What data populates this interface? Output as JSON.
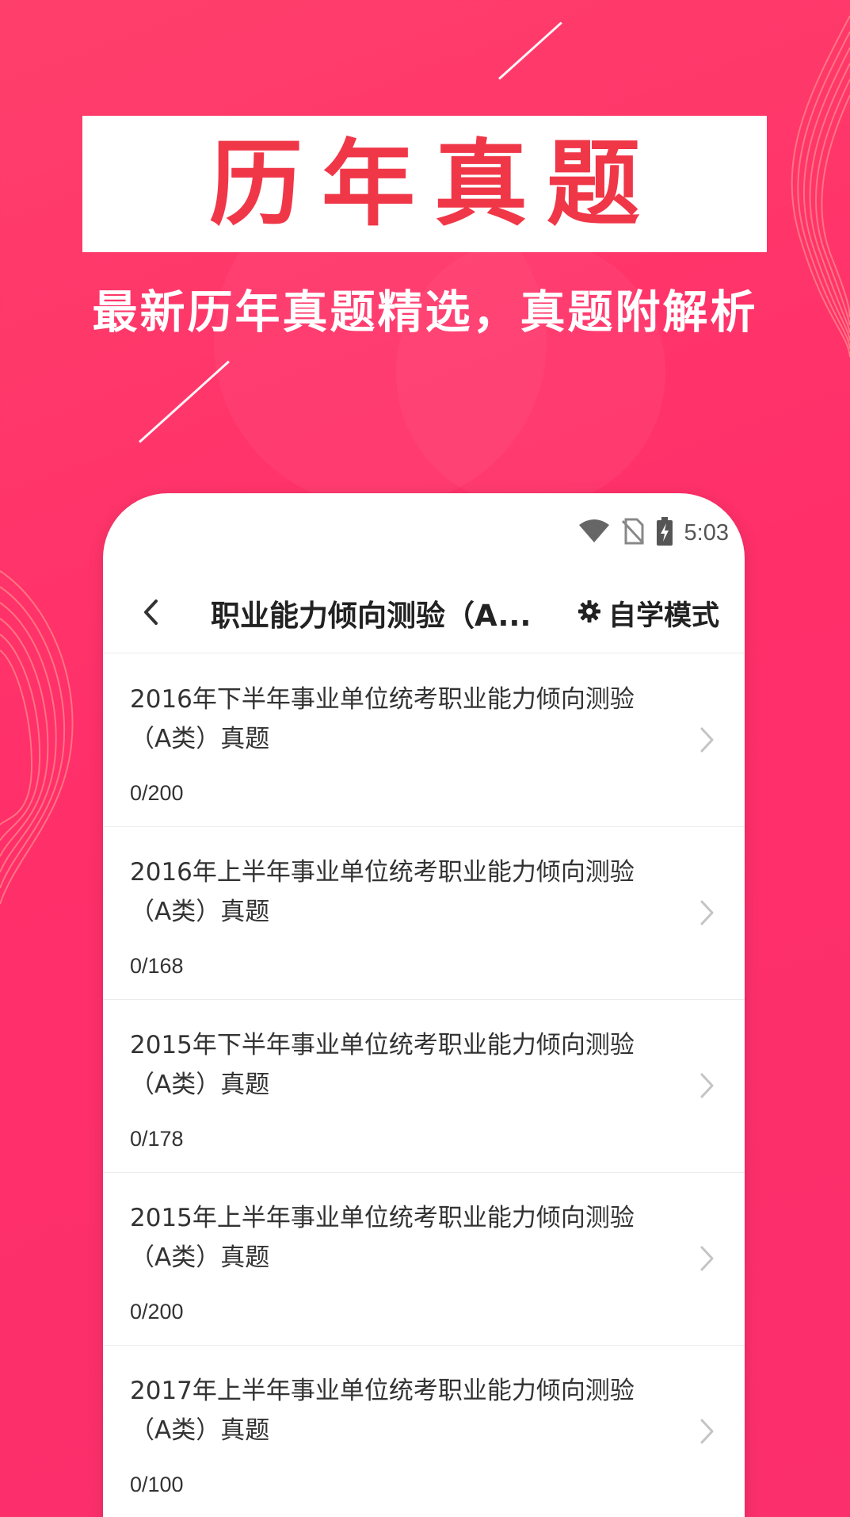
{
  "promo": {
    "title": "历年真题",
    "subtitle": "最新历年真题精选，真题附解析"
  },
  "status_bar": {
    "time": "5:03",
    "icons": [
      "wifi-icon",
      "no-sim-icon",
      "battery-charging-icon"
    ]
  },
  "header": {
    "back_icon": "chevron-left-icon",
    "title": "职业能力倾向测验（A...",
    "mode_icon": "gear-icon",
    "mode_label": "自学模式"
  },
  "exams": [
    {
      "title_line1": "2016年下半年事业单位统考职业能力倾向测验",
      "title_line2": "（A类）真题",
      "progress": "0/200"
    },
    {
      "title_line1": "2016年上半年事业单位统考职业能力倾向测验",
      "title_line2": "（A类）真题",
      "progress": "0/168"
    },
    {
      "title_line1": "2015年下半年事业单位统考职业能力倾向测验",
      "title_line2": "（A类）真题",
      "progress": "0/178"
    },
    {
      "title_line1": "2015年上半年事业单位统考职业能力倾向测验",
      "title_line2": "（A类）真题",
      "progress": "0/200"
    },
    {
      "title_line1": "2017年上半年事业单位统考职业能力倾向测验",
      "title_line2": "（A类）真题",
      "progress": "0/100"
    }
  ],
  "colors": {
    "background": "#ff3366",
    "title_red": "#f03748",
    "text_dark": "#222222",
    "divider": "#ececec"
  }
}
